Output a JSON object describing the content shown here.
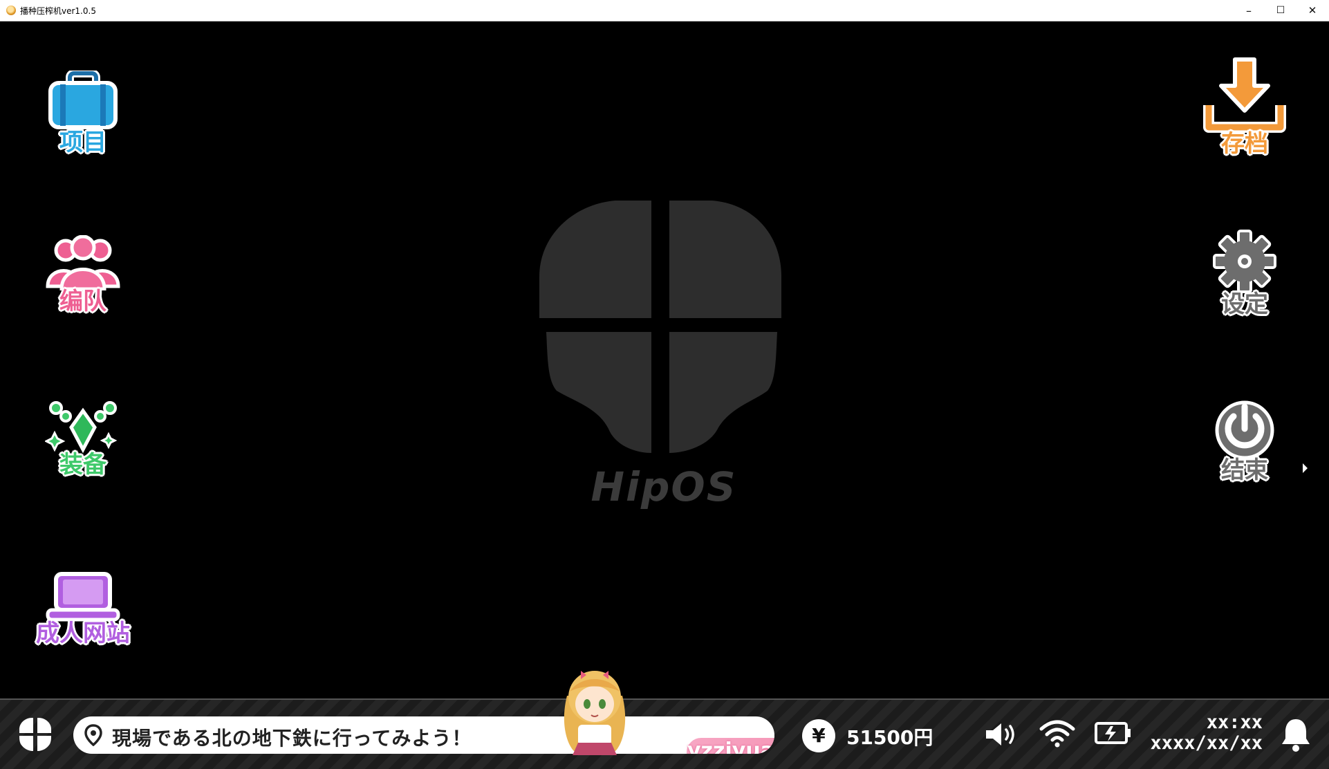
{
  "window": {
    "title": "播种压榨机ver1.0.5",
    "minimize_glyph": "–",
    "maximize_glyph": "☐",
    "close_glyph": "✕"
  },
  "desktop": {
    "logo_text": "HipOS",
    "left_apps": [
      {
        "label": "项目",
        "icon": "briefcase-icon",
        "color": "#2aa7e0"
      },
      {
        "label": "编队",
        "icon": "team-icon",
        "color": "#ee5f92"
      },
      {
        "label": "装备",
        "icon": "gem-icon",
        "color": "#3ec96a"
      },
      {
        "label": "成人网站",
        "icon": "laptop-icon",
        "color": "#b15fe0"
      }
    ],
    "right_apps": [
      {
        "label": "存档",
        "icon": "download-icon",
        "color": "#f39a3a"
      },
      {
        "label": "设定",
        "icon": "gear-icon",
        "color": "#6d6d6d"
      },
      {
        "label": "结束",
        "icon": "power-icon",
        "color": "#6d6d6d"
      }
    ]
  },
  "taskbar": {
    "mission_text": "現場である北の地下鉄に行ってみよう！",
    "watermark": "yzziyuan.com",
    "currency_symbol": "¥",
    "money": "51500円",
    "time": "xx:xx",
    "date": "xxxx/xx/xx",
    "tray_icons": [
      "volume-icon",
      "wifi-icon",
      "battery-icon",
      "bell-icon"
    ]
  }
}
